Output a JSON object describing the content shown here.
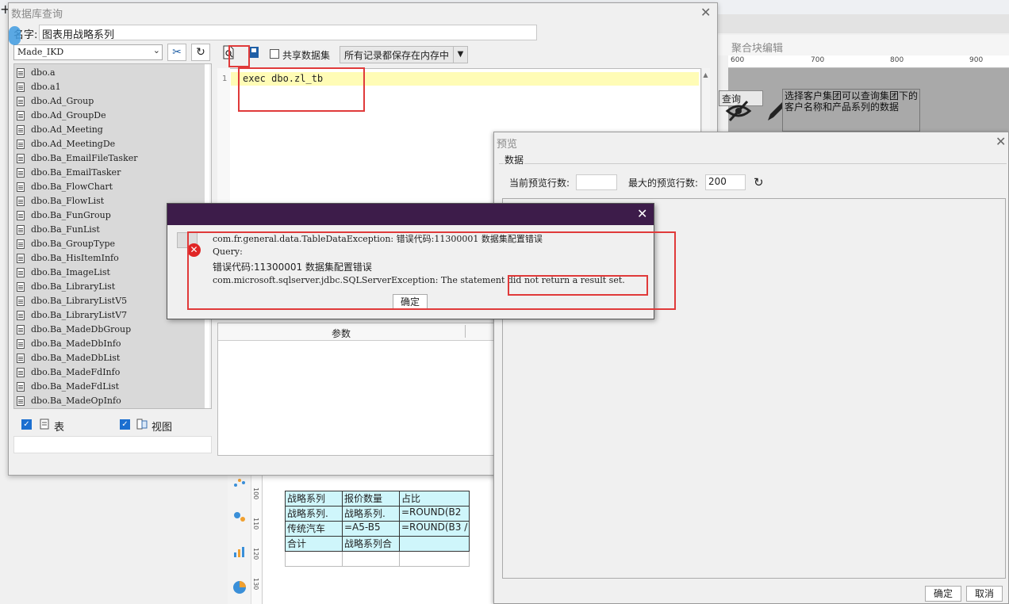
{
  "background": {
    "panel_title": "聚合块编辑",
    "ruler_ticks": [
      "600",
      "700",
      "800",
      "900"
    ],
    "query_button": "查询",
    "note_text": "选择客户集团可以查询集团下的客户名称和产品系列的数据",
    "vruler_ticks": [
      "100",
      "110",
      "120",
      "130"
    ],
    "report_table": [
      [
        "战略系列",
        "报价数量",
        "占比"
      ],
      [
        "战略系列.",
        "战略系列.",
        "=ROUND(B2"
      ],
      [
        "传统汽车",
        "=A5-B5",
        "=ROUND(B3 /"
      ],
      [
        "合计",
        "战略系列合",
        ""
      ],
      [
        "",
        "",
        ""
      ]
    ]
  },
  "db_dialog": {
    "title": "数据库查询",
    "name_label": "名字:",
    "name_value": "图表用战略系列",
    "datasource": "Made_IKD",
    "share_label": "共享数据集",
    "memory_option": "所有记录都保存在内存中",
    "tables": [
      "dbo.a",
      "dbo.a1",
      "dbo.Ad_Group",
      "dbo.Ad_GroupDe",
      "dbo.Ad_Meeting",
      "dbo.Ad_MeetingDe",
      "dbo.Ba_EmailFileTasker",
      "dbo.Ba_EmailTasker",
      "dbo.Ba_FlowChart",
      "dbo.Ba_FlowList",
      "dbo.Ba_FunGroup",
      "dbo.Ba_FunList",
      "dbo.Ba_GroupType",
      "dbo.Ba_HisItemInfo",
      "dbo.Ba_ImageList",
      "dbo.Ba_LibraryList",
      "dbo.Ba_LibraryListV5",
      "dbo.Ba_LibraryListV7",
      "dbo.Ba_MadeDbGroup",
      "dbo.Ba_MadeDbInfo",
      "dbo.Ba_MadeDbList",
      "dbo.Ba_MadeFdInfo",
      "dbo.Ba_MadeFdList",
      "dbo.Ba_MadeOpInfo"
    ],
    "check_table_label": "表",
    "check_view_label": "视图",
    "sql_line_number": "1",
    "sql": "exec dbo.zl_tb",
    "param_header": "参数"
  },
  "preview": {
    "title": "预览",
    "group_title": "数据",
    "current_rows_label": "当前预览行数:",
    "current_rows_value": "",
    "max_rows_label": "最大的预览行数:",
    "max_rows_value": "200",
    "ok": "确定",
    "cancel": "取消"
  },
  "error": {
    "line1": "com.fr.general.data.TableDataException: 错误代码:11300001 数据集配置错误",
    "line2": "Query:",
    "line3": "错误代码:11300001 数据集配置错误",
    "line4": "com.microsoft.sqlserver.jdbc.SQLServerException: The statement did not return a result set.",
    "ok": "确定"
  },
  "colors": {
    "highlight": "#e03a3a",
    "error_titlebar": "#3d1c4a",
    "sql_line_bg": "#fffcb6",
    "report_cell_bg": "#cff6fb"
  }
}
